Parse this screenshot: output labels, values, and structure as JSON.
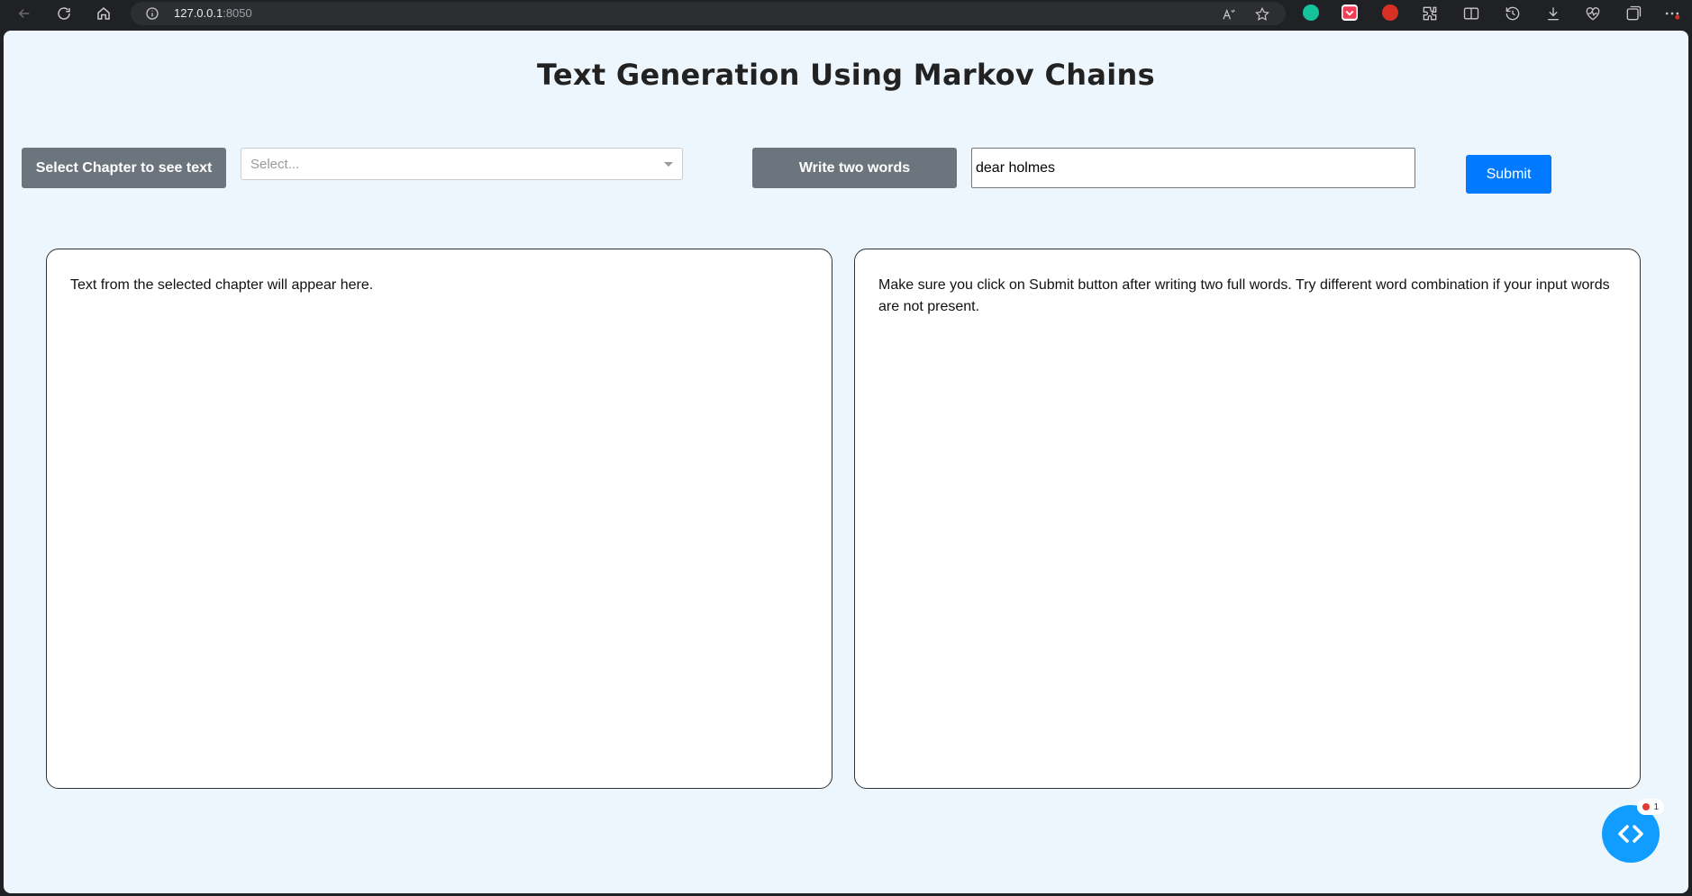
{
  "browser": {
    "url_host": "127.0.0.1",
    "url_port": ":8050"
  },
  "page": {
    "title": "Text Generation Using Markov Chains",
    "chapter_label": "Select Chapter to see text",
    "chapter_placeholder": "Select...",
    "words_label": "Write two words",
    "words_value": "dear holmes",
    "submit_label": "Submit",
    "chapter_text": "Text from the selected chapter will appear here.",
    "generated_text": "Make sure you click on Submit button after writing two full words. Try different word combination if your input words are not present."
  },
  "devtools": {
    "badge_count": "1",
    "accent": "#119dff"
  },
  "colors": {
    "background": "#eef6fd",
    "label_button": "#6c757d",
    "submit_button": "#007bff"
  }
}
